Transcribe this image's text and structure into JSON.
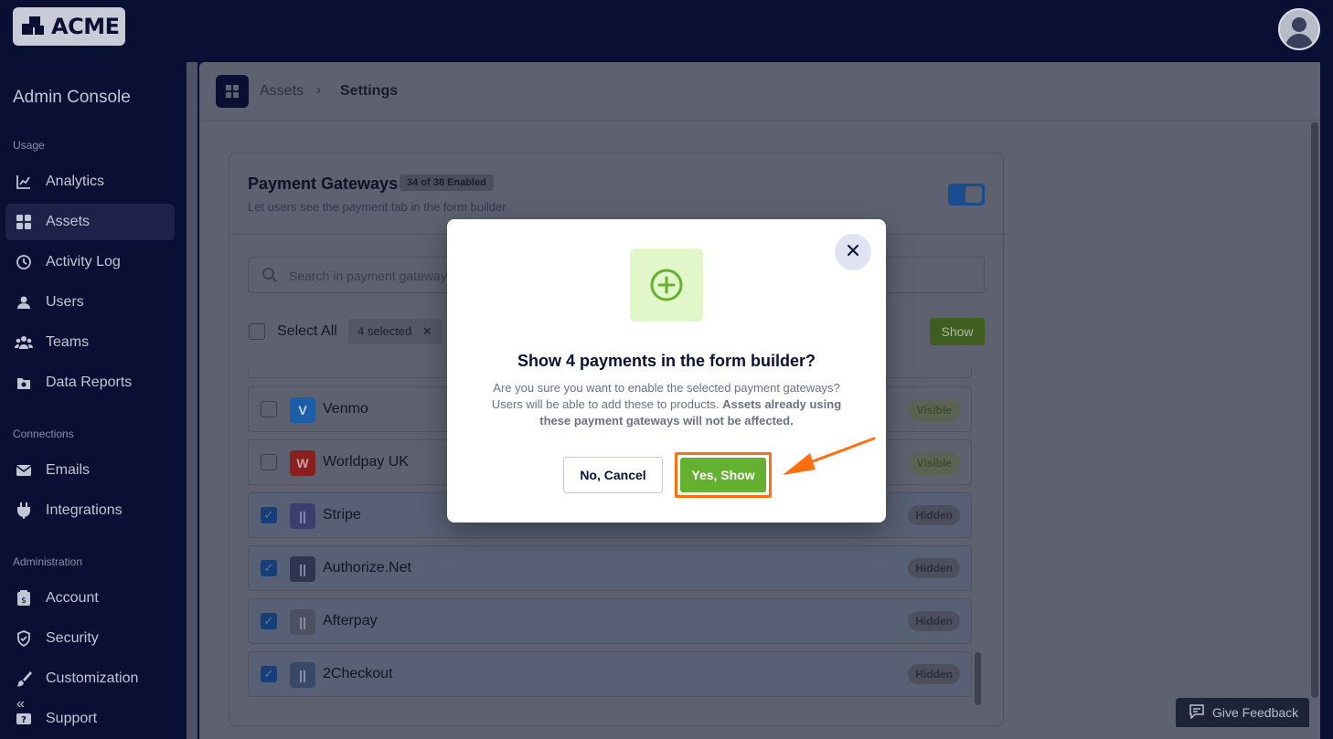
{
  "header": {
    "logo_text": "ACME"
  },
  "sidebar": {
    "title": "Admin Console",
    "sections": {
      "usage": "Usage",
      "connections": "Connections",
      "administration": "Administration"
    },
    "items": [
      {
        "label": "Analytics",
        "icon": "chart-line-icon"
      },
      {
        "label": "Assets",
        "icon": "grid-icon"
      },
      {
        "label": "Activity Log",
        "icon": "clock-icon"
      },
      {
        "label": "Users",
        "icon": "user-icon"
      },
      {
        "label": "Teams",
        "icon": "team-icon"
      },
      {
        "label": "Data Reports",
        "icon": "report-icon"
      },
      {
        "label": "Emails",
        "icon": "mail-icon"
      },
      {
        "label": "Integrations",
        "icon": "plug-icon"
      },
      {
        "label": "Account",
        "icon": "account-icon"
      },
      {
        "label": "Security",
        "icon": "shield-icon"
      },
      {
        "label": "Customization",
        "icon": "brush-icon"
      },
      {
        "label": "Support",
        "icon": "support-icon"
      }
    ],
    "active": "Assets"
  },
  "breadcrumb": {
    "parent": "Assets",
    "separator": "›",
    "current": "Settings"
  },
  "card": {
    "title": "Payment Gateways",
    "badge": "34 of 38 Enabled",
    "subtitle": "Let users see the payment tab in the form builder",
    "search_placeholder": "Search in payment gateways",
    "select_all": "Select All",
    "selected_chip": "4 selected",
    "show_button": "Show",
    "rows": [
      {
        "name": "Venmo",
        "status": "Visible",
        "checked": false,
        "logo": "V"
      },
      {
        "name": "Worldpay UK",
        "status": "Visible",
        "checked": false,
        "logo": "W"
      },
      {
        "name": "Stripe",
        "status": "Hidden",
        "checked": true,
        "logo": "||"
      },
      {
        "name": "Authorize.Net",
        "status": "Hidden",
        "checked": true,
        "logo": "||"
      },
      {
        "name": "Afterpay",
        "status": "Hidden",
        "checked": true,
        "logo": "||"
      },
      {
        "name": "2Checkout",
        "status": "Hidden",
        "checked": true,
        "logo": "||"
      }
    ]
  },
  "modal": {
    "title": "Show 4 payments in the form builder?",
    "body_plain": "Are you sure you want to enable the selected payment gateways? Users will be able to add these to products.",
    "body_bold": "Assets already using these payment gateways will not be affected.",
    "cancel_label": "No, Cancel",
    "confirm_label": "Yes, Show"
  },
  "feedback": {
    "label": "Give Feedback"
  },
  "colors": {
    "navy": "#0a1033",
    "confirm_green": "#64b02f",
    "highlight_orange": "#ff6f0f"
  }
}
